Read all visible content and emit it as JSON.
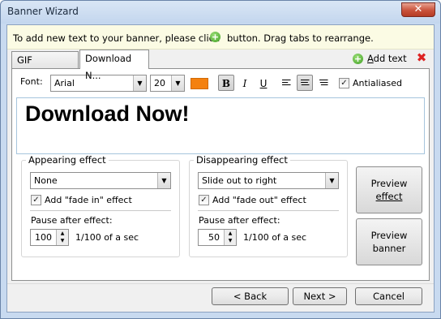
{
  "window": {
    "title": "Banner Wizard",
    "close_glyph": "✕"
  },
  "hint": {
    "before": "To add new text to your banner, please click",
    "after": "button. Drag tabs to rearrange.",
    "icon": "plus-circle-icon"
  },
  "tabs": [
    {
      "label": "GIF Animator"
    },
    {
      "label": "Download N..."
    }
  ],
  "tab_actions": {
    "add_text": "Add text",
    "add_text_accel": "A",
    "add_text_rest": "dd text",
    "delete_glyph": "✖"
  },
  "font": {
    "label": "Font:",
    "family": "Arial",
    "size": "20",
    "color": "#f4810f",
    "bold": "B",
    "italic": "I",
    "underline": "U",
    "antialiased_label": "Antialiased",
    "antialiased": true
  },
  "editor": {
    "text": "Download Now!"
  },
  "appearing": {
    "title": "Appearing effect",
    "effect": "None",
    "fade_label": "Add \"fade in\" effect",
    "fade_checked": true,
    "pause_label": "Pause after effect:",
    "pause_value": "100",
    "unit": "1/100 of a sec"
  },
  "disappearing": {
    "title": "Disappearing effect",
    "effect": "Slide out to right",
    "fade_label": "Add \"fade out\" effect",
    "fade_checked": true,
    "pause_label": "Pause after effect:",
    "pause_value": "50",
    "unit": "1/100 of a sec"
  },
  "preview": {
    "effect_line1": "Preview",
    "effect_line2": "effect",
    "banner_line1": "Preview",
    "banner_line2": "banner"
  },
  "footer": {
    "back": "< Back",
    "next": "Next >",
    "cancel": "Cancel"
  },
  "check_glyph": "✓"
}
